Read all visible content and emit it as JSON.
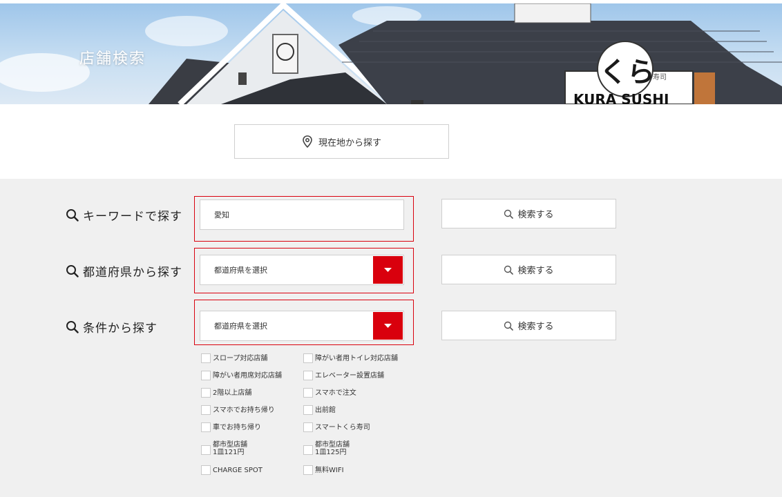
{
  "hero": {
    "title": "店舗検索",
    "store_sign": "KURA SUSHI",
    "store_logo": "くら",
    "store_logo_mark": "寿司"
  },
  "location_button": {
    "label": "現在地から探す",
    "icon": "map-pin-icon"
  },
  "keyword_search": {
    "label": "キーワードで探す",
    "value": "愛知",
    "button_label": "検索する"
  },
  "prefecture_search": {
    "label": "都道府県から探す",
    "select_value": "都道府県を選択",
    "button_label": "検索する"
  },
  "condition_search": {
    "label": "条件から探す",
    "select_value": "都道府県を選択",
    "button_label": "検索する",
    "options": [
      {
        "label": "スロープ対応店舗"
      },
      {
        "label": "障がい者用トイレ対応店舗"
      },
      {
        "label": "障がい者用席対応店舗"
      },
      {
        "label": "エレベーター設置店舗"
      },
      {
        "label": "2階以上店舗"
      },
      {
        "label": "スマホで注文"
      },
      {
        "label": "スマホでお持ち帰り"
      },
      {
        "label": "出前館"
      },
      {
        "label": "車でお持ち帰り"
      },
      {
        "label": "スマートくら寿司"
      },
      {
        "label": "都市型店舗",
        "label2": "1皿121円"
      },
      {
        "label": "都市型店舗",
        "label2": "1皿125円"
      },
      {
        "label": "CHARGE SPOT"
      },
      {
        "label": "無料WIFI"
      }
    ]
  },
  "colors": {
    "accent_red": "#d9000d",
    "search_bg": "#f0f0f0",
    "border": "#cfcfcf"
  }
}
